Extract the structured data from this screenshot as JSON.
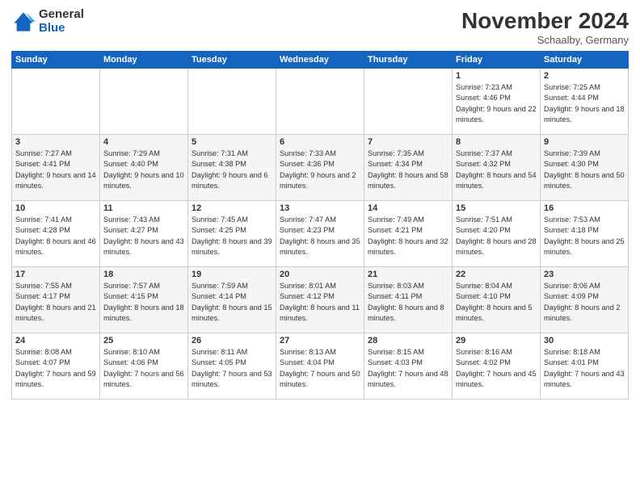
{
  "logo": {
    "general": "General",
    "blue": "Blue"
  },
  "header": {
    "month": "November 2024",
    "location": "Schaalby, Germany"
  },
  "days_of_week": [
    "Sunday",
    "Monday",
    "Tuesday",
    "Wednesday",
    "Thursday",
    "Friday",
    "Saturday"
  ],
  "weeks": [
    [
      {
        "day": "",
        "info": ""
      },
      {
        "day": "",
        "info": ""
      },
      {
        "day": "",
        "info": ""
      },
      {
        "day": "",
        "info": ""
      },
      {
        "day": "",
        "info": ""
      },
      {
        "day": "1",
        "info": "Sunrise: 7:23 AM\nSunset: 4:46 PM\nDaylight: 9 hours and 22 minutes."
      },
      {
        "day": "2",
        "info": "Sunrise: 7:25 AM\nSunset: 4:44 PM\nDaylight: 9 hours and 18 minutes."
      }
    ],
    [
      {
        "day": "3",
        "info": "Sunrise: 7:27 AM\nSunset: 4:41 PM\nDaylight: 9 hours and 14 minutes."
      },
      {
        "day": "4",
        "info": "Sunrise: 7:29 AM\nSunset: 4:40 PM\nDaylight: 9 hours and 10 minutes."
      },
      {
        "day": "5",
        "info": "Sunrise: 7:31 AM\nSunset: 4:38 PM\nDaylight: 9 hours and 6 minutes."
      },
      {
        "day": "6",
        "info": "Sunrise: 7:33 AM\nSunset: 4:36 PM\nDaylight: 9 hours and 2 minutes."
      },
      {
        "day": "7",
        "info": "Sunrise: 7:35 AM\nSunset: 4:34 PM\nDaylight: 8 hours and 58 minutes."
      },
      {
        "day": "8",
        "info": "Sunrise: 7:37 AM\nSunset: 4:32 PM\nDaylight: 8 hours and 54 minutes."
      },
      {
        "day": "9",
        "info": "Sunrise: 7:39 AM\nSunset: 4:30 PM\nDaylight: 8 hours and 50 minutes."
      }
    ],
    [
      {
        "day": "10",
        "info": "Sunrise: 7:41 AM\nSunset: 4:28 PM\nDaylight: 8 hours and 46 minutes."
      },
      {
        "day": "11",
        "info": "Sunrise: 7:43 AM\nSunset: 4:27 PM\nDaylight: 8 hours and 43 minutes."
      },
      {
        "day": "12",
        "info": "Sunrise: 7:45 AM\nSunset: 4:25 PM\nDaylight: 8 hours and 39 minutes."
      },
      {
        "day": "13",
        "info": "Sunrise: 7:47 AM\nSunset: 4:23 PM\nDaylight: 8 hours and 35 minutes."
      },
      {
        "day": "14",
        "info": "Sunrise: 7:49 AM\nSunset: 4:21 PM\nDaylight: 8 hours and 32 minutes."
      },
      {
        "day": "15",
        "info": "Sunrise: 7:51 AM\nSunset: 4:20 PM\nDaylight: 8 hours and 28 minutes."
      },
      {
        "day": "16",
        "info": "Sunrise: 7:53 AM\nSunset: 4:18 PM\nDaylight: 8 hours and 25 minutes."
      }
    ],
    [
      {
        "day": "17",
        "info": "Sunrise: 7:55 AM\nSunset: 4:17 PM\nDaylight: 8 hours and 21 minutes."
      },
      {
        "day": "18",
        "info": "Sunrise: 7:57 AM\nSunset: 4:15 PM\nDaylight: 8 hours and 18 minutes."
      },
      {
        "day": "19",
        "info": "Sunrise: 7:59 AM\nSunset: 4:14 PM\nDaylight: 8 hours and 15 minutes."
      },
      {
        "day": "20",
        "info": "Sunrise: 8:01 AM\nSunset: 4:12 PM\nDaylight: 8 hours and 11 minutes."
      },
      {
        "day": "21",
        "info": "Sunrise: 8:03 AM\nSunset: 4:11 PM\nDaylight: 8 hours and 8 minutes."
      },
      {
        "day": "22",
        "info": "Sunrise: 8:04 AM\nSunset: 4:10 PM\nDaylight: 8 hours and 5 minutes."
      },
      {
        "day": "23",
        "info": "Sunrise: 8:06 AM\nSunset: 4:09 PM\nDaylight: 8 hours and 2 minutes."
      }
    ],
    [
      {
        "day": "24",
        "info": "Sunrise: 8:08 AM\nSunset: 4:07 PM\nDaylight: 7 hours and 59 minutes."
      },
      {
        "day": "25",
        "info": "Sunrise: 8:10 AM\nSunset: 4:06 PM\nDaylight: 7 hours and 56 minutes."
      },
      {
        "day": "26",
        "info": "Sunrise: 8:11 AM\nSunset: 4:05 PM\nDaylight: 7 hours and 53 minutes."
      },
      {
        "day": "27",
        "info": "Sunrise: 8:13 AM\nSunset: 4:04 PM\nDaylight: 7 hours and 50 minutes."
      },
      {
        "day": "28",
        "info": "Sunrise: 8:15 AM\nSunset: 4:03 PM\nDaylight: 7 hours and 48 minutes."
      },
      {
        "day": "29",
        "info": "Sunrise: 8:16 AM\nSunset: 4:02 PM\nDaylight: 7 hours and 45 minutes."
      },
      {
        "day": "30",
        "info": "Sunrise: 8:18 AM\nSunset: 4:01 PM\nDaylight: 7 hours and 43 minutes."
      }
    ]
  ]
}
